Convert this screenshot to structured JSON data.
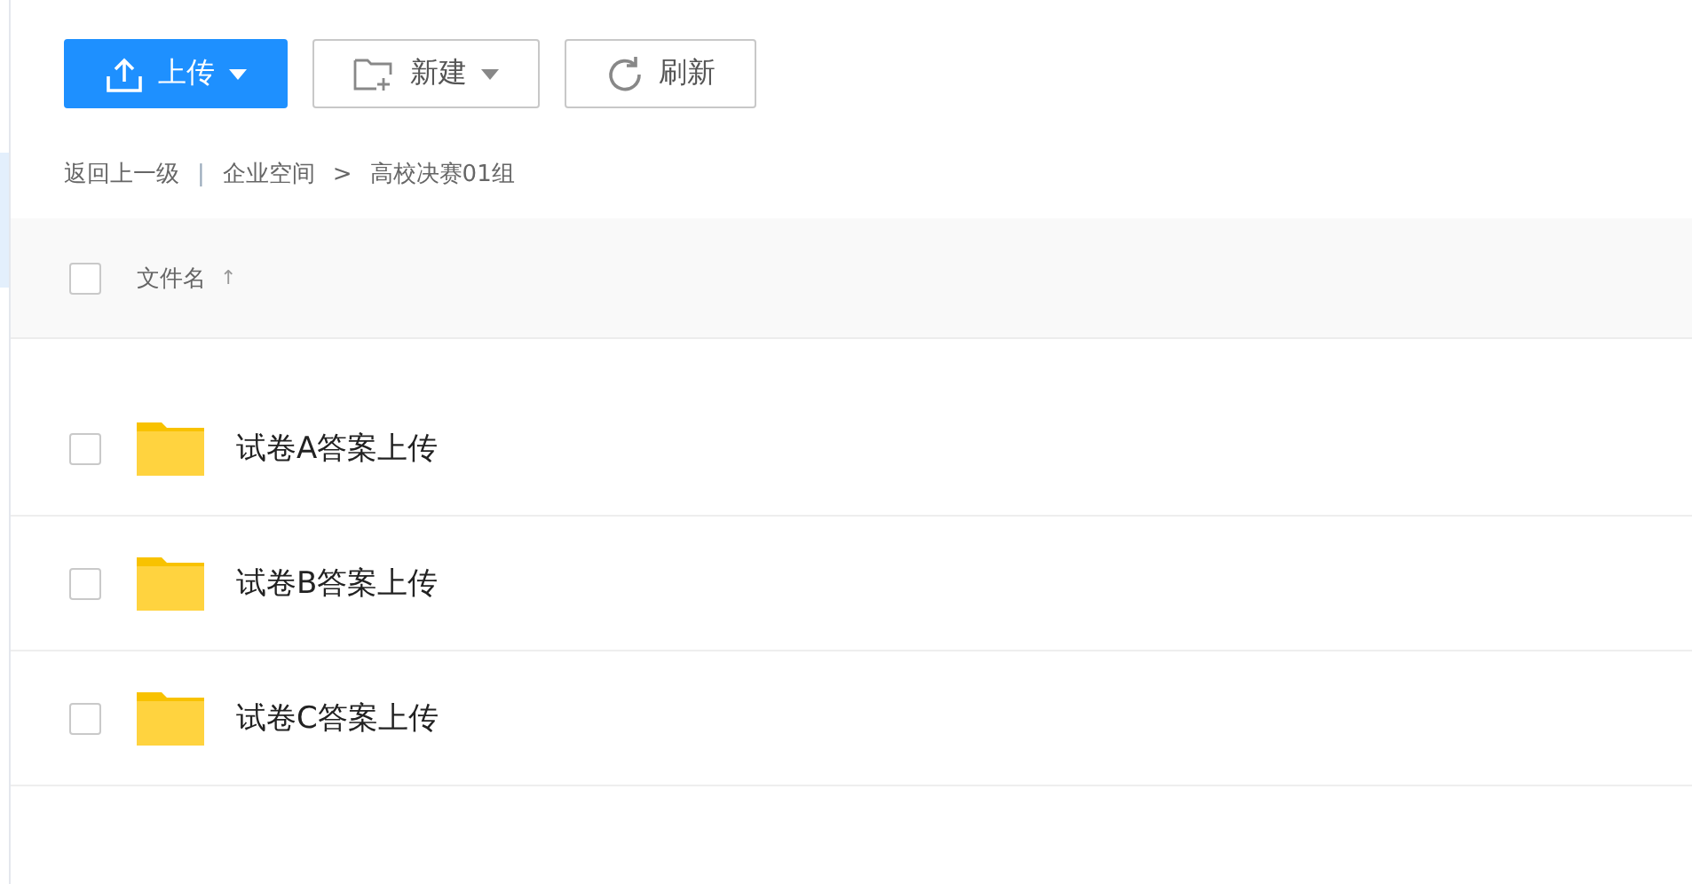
{
  "toolbar": {
    "buttons": [
      {
        "kind": "upload",
        "label": "上传",
        "primary": true,
        "dropdown": true
      },
      {
        "kind": "new-folder",
        "label": "新建",
        "primary": false,
        "dropdown": true
      },
      {
        "kind": "refresh",
        "label": "刷新",
        "primary": false,
        "dropdown": false
      }
    ]
  },
  "breadcrumb": {
    "back": "返回上一级",
    "separator": "|",
    "items": [
      "企业空间",
      "高校决赛01组"
    ],
    "arrow": ">"
  },
  "table": {
    "select_all": {
      "checked": false
    },
    "column": {
      "label": "文件名",
      "sort_arrow": "↑"
    },
    "rows": [
      {
        "name": "试卷A答案上传",
        "checked": false
      },
      {
        "name": "试卷B答案上传",
        "checked": false
      },
      {
        "name": "试卷C答案上传",
        "checked": false
      }
    ]
  }
}
